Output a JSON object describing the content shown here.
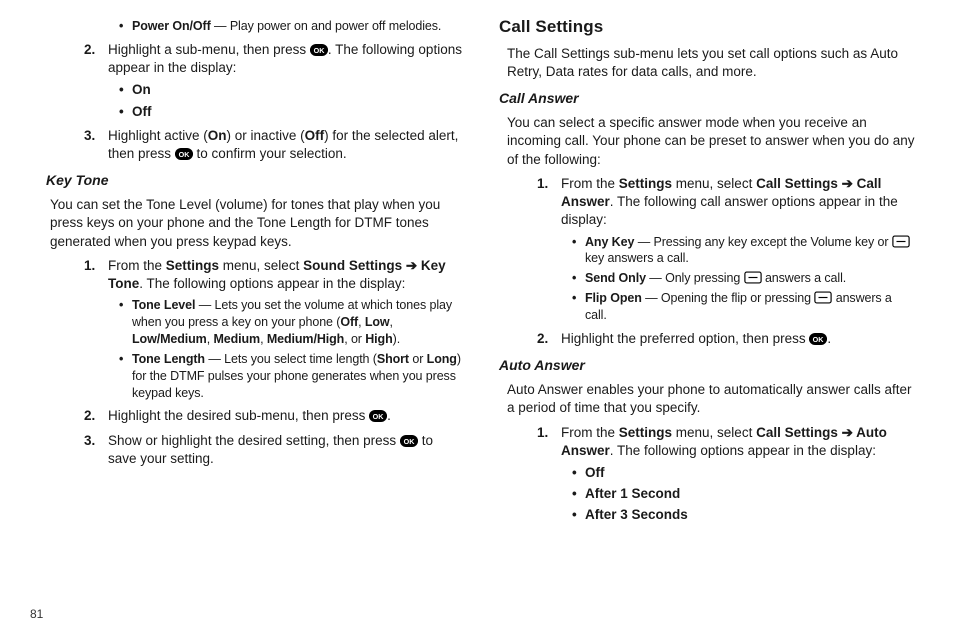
{
  "pageNumber": "81",
  "left": {
    "powerOnOff_label": "Power On/Off",
    "powerOnOff_text": " — Play power on and power off melodies.",
    "step2_a": "Highlight a sub-menu, then press ",
    "step2_b": ". The following options appear in the display:",
    "on": "On",
    "off": "Off",
    "step3_a": "Highlight active (",
    "step3_on": "On",
    "step3_b": ") or inactive (",
    "step3_off": "Off",
    "step3_c": ") for the selected alert, then press ",
    "step3_d": " to confirm your selection.",
    "keyTone_h": "Key Tone",
    "keyTone_p": "You can set the Tone Level (volume) for tones that play when you press keys on your phone and the Tone Length for DTMF tones generated when you press keypad keys.",
    "kt1_a": "From the ",
    "kt1_settings": "Settings",
    "kt1_b": " menu, select ",
    "kt1_sound": "Sound Settings ➔ Key Tone",
    "kt1_c": ". The following options appear in the display:",
    "toneLevel_lab": "Tone Level",
    "toneLevel_a": " — Lets you set the volume at which tones play when you press a key on your phone (",
    "tl_off": "Off",
    "sep": ", ",
    "tl_low": "Low",
    "tl_lowmed": "Low/Medium",
    "tl_med": "Medium",
    "tl_medhigh": "Medium/High",
    "or": ", or ",
    "tl_high": "High",
    "toneLevel_b": ").",
    "toneLength_lab": "Tone Length",
    "toneLength_a": " — Lets you select time length (",
    "tl_short": "Short",
    "word_or": " or ",
    "tl_long": "Long",
    "toneLength_b": ") for the DTMF pulses your phone generates when you press keypad keys.",
    "kt2_a": "Highlight the desired sub-menu, then press ",
    "kt2_b": ".",
    "kt3_a": "Show or highlight the desired setting, then press ",
    "kt3_b": " to save your setting."
  },
  "right": {
    "callSettings_h": "Call Settings",
    "callSettings_p": "The Call Settings sub-menu lets you set call options such as Auto Retry, Data rates for data calls, and more.",
    "callAnswer_h": "Call Answer",
    "callAnswer_p": "You can select a specific answer mode when you receive an incoming call. Your phone can be preset to answer when you do any of the following:",
    "ca1_a": "From the ",
    "ca1_settings": "Settings",
    "ca1_b": " menu, select ",
    "ca1_path": "Call Settings ➔ Call Answer",
    "ca1_c": ". The following call answer options appear in the display:",
    "anyKey_lab": "Any Key",
    "anyKey_a": " — Pressing any key except the Volume key or ",
    "anyKey_b": " key answers a call.",
    "sendOnly_lab": "Send Only",
    "sendOnly_a": " — Only pressing ",
    "sendOnly_b": " answers a call.",
    "flipOpen_lab": "Flip Open",
    "flipOpen_a": " — Opening the flip or pressing ",
    "flipOpen_b": " answers a call.",
    "ca2_a": "Highlight the preferred option, then press ",
    "ca2_b": ".",
    "autoAnswer_h": "Auto Answer",
    "autoAnswer_p": "Auto Answer enables your phone to automatically answer calls after a period of time that you specify.",
    "aa1_a": "From the ",
    "aa1_settings": "Settings",
    "aa1_b": " menu, select ",
    "aa1_path": "Call Settings ➔ Auto Answer",
    "aa1_c": ". The following options appear in the display:",
    "aa_off": "Off",
    "aa_1s": "After 1 Second",
    "aa_3s": "After 3 Seconds"
  }
}
